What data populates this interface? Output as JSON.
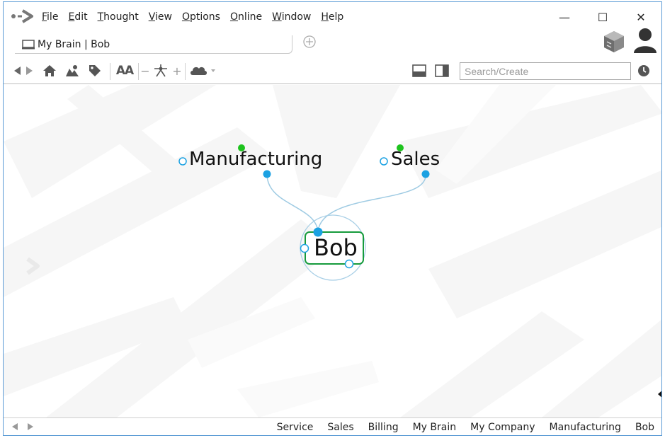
{
  "menu": {
    "items": [
      "File",
      "Edit",
      "Thought",
      "View",
      "Options",
      "Online",
      "Window",
      "Help"
    ]
  },
  "window_controls": {
    "minimize": "—",
    "maximize": "☐",
    "close": "✕"
  },
  "tab": {
    "label": "My Brain | Bob"
  },
  "toolbar": {
    "font_size_label": "AA",
    "zoom_out_label": "−",
    "zoom_in_label": "+",
    "search_placeholder": "Search/Create"
  },
  "plex": {
    "parents": [
      "Manufacturing",
      "Sales"
    ],
    "active_thought": "Bob",
    "accent_color": "#1ba1e2",
    "gate_green": "#1ec31e",
    "link_color": "#9fcbe3"
  },
  "statusbar": {
    "history": [
      "Service",
      "Sales",
      "Billing",
      "My Brain",
      "My Company",
      "Manufacturing",
      "Bob"
    ]
  },
  "icons": {
    "app": "thebrain-logo-icon",
    "tab": "brain-window-icon",
    "new_tab": "add-tab-icon",
    "sync": "cube-icon",
    "account": "user-icon",
    "back": "back-arrow-icon",
    "forward": "forward-arrow-icon",
    "home": "home-icon",
    "pins": "pin-icon",
    "tags": "tag-icon",
    "layout": "layout-icon",
    "cloud": "cloud-icon",
    "notes_bottom": "panel-bottom-icon",
    "notes_right": "panel-right-icon",
    "timeline": "clock-icon"
  }
}
